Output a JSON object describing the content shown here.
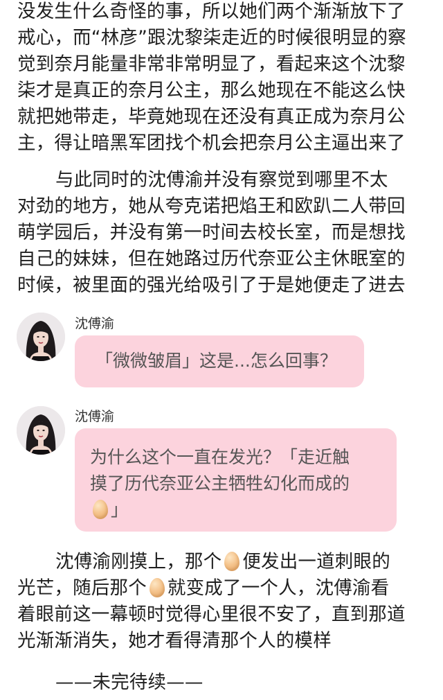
{
  "paragraph1": {
    "lines": [
      "没发生什么奇怪的事，所以她们两个渐渐放下了",
      "戒心，而“林彦”跟沈黎柒走近的时候很明显的察",
      "觉到奈月能量非常非常明显了，看起来这个沈黎",
      "柒才是真正的奈月公主，那么她现在不能这么快",
      "就把她带走，毕竟她现在还没有真正成为奈月公",
      "主，得让暗黑军团找个机会把奈月公主逼出来了"
    ]
  },
  "paragraph2": {
    "lines": [
      "与此同时的沈傅渝并没有察觉到哪里不太",
      "对劲的地方，她从夸克诺把焰王和欧趴二人带回",
      "萌学园后，并没有第一时间去校长室，而是想找",
      "自己的妹妹，但在她路过历代奈亚公主休眠室的",
      "时候，被里面的强光给吸引了于是她便走了进去"
    ]
  },
  "messages": [
    {
      "sender": "沈傅渝",
      "lines": [
        "「微微皱眉」这是...怎么回事？"
      ]
    },
    {
      "sender": "沈傅渝",
      "lines": [
        "为什么这个一直在发光？「走近触",
        "摸了历代奈亚公主牺牲幻化而成的"
      ],
      "last_line_suffix": "」"
    }
  ],
  "paragraph3": {
    "line1_a": "沈傅渝刚摸上，那个",
    "line1_b": "便发出一道刺眼的",
    "line2_a": "光芒，随后那个",
    "line2_b": "就变成了一个人，沈傅渝看",
    "line3": "着眼前这一幕顿时觉得心里很不安了，直到那道",
    "line4": "光渐渐消失，她才看得清那个人的模样"
  },
  "ending": "——未完待续——",
  "icons": {
    "egg": "egg-emoji-icon",
    "avatar": "avatar-portrait"
  },
  "colors": {
    "bubble": "#fcd3dd",
    "text": "#1f1f1f",
    "bubble_text": "#555555"
  }
}
